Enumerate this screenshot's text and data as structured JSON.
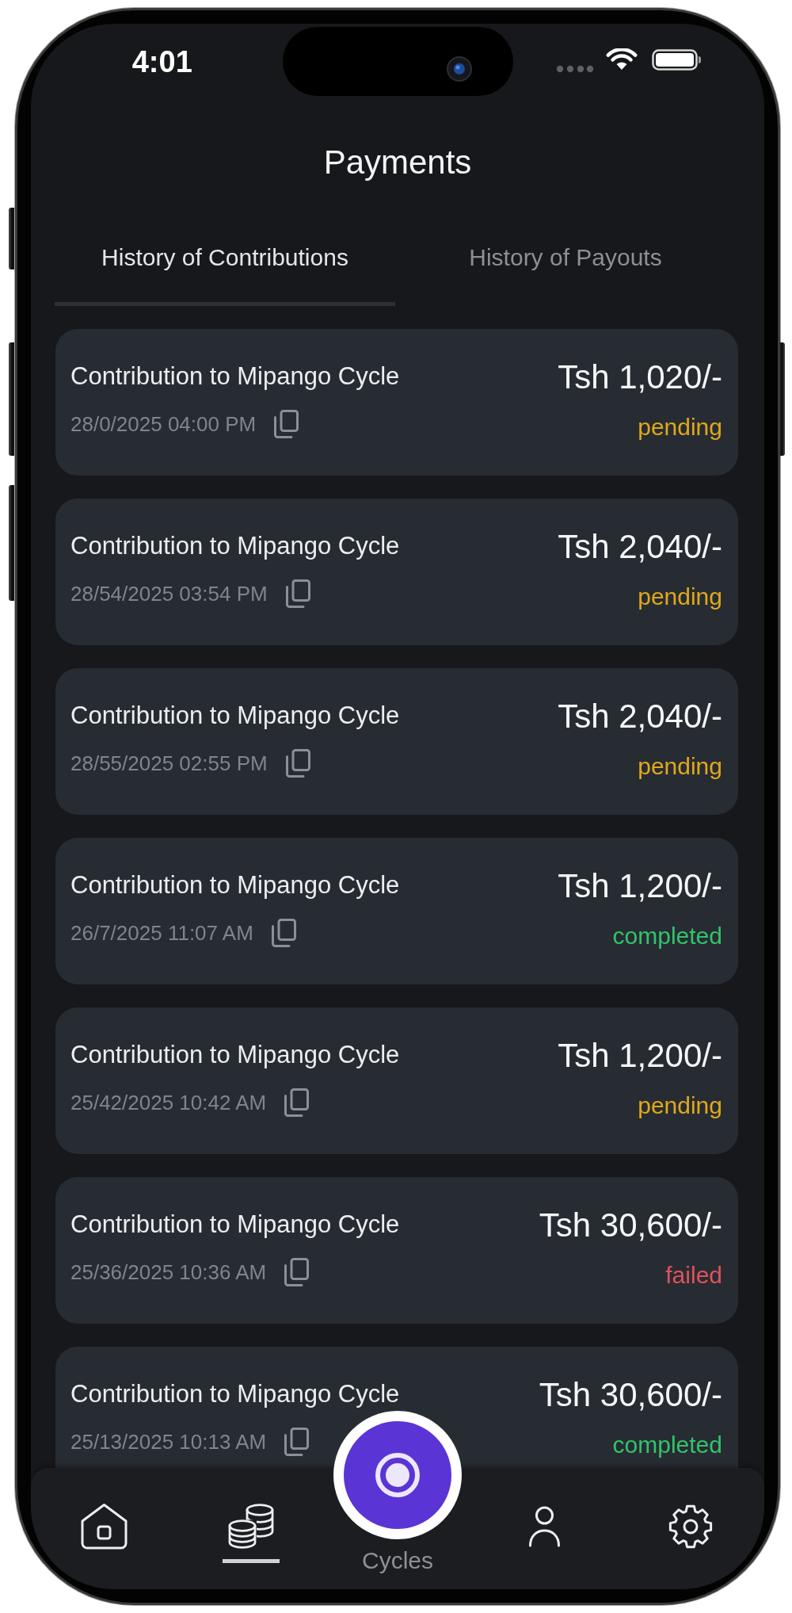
{
  "status_bar": {
    "time": "4:01"
  },
  "header": {
    "title": "Payments"
  },
  "tabs": [
    {
      "label": "History of Contributions",
      "selected": true
    },
    {
      "label": "History of Payouts",
      "selected": false
    }
  ],
  "payments": [
    {
      "title": "Contribution to Mipango Cycle",
      "date": "28/0/2025 04:00 PM",
      "amount": "Tsh 1,020/-",
      "status": "pending",
      "color": "#e0a81b"
    },
    {
      "title": "Contribution to Mipango Cycle",
      "date": "28/54/2025 03:54 PM",
      "amount": "Tsh 2,040/-",
      "status": "pending",
      "color": "#e0a81b"
    },
    {
      "title": "Contribution to Mipango Cycle",
      "date": "28/55/2025 02:55 PM",
      "amount": "Tsh 2,040/-",
      "status": "pending",
      "color": "#e0a81b"
    },
    {
      "title": "Contribution to Mipango Cycle",
      "date": "26/7/2025 11:07 AM",
      "amount": "Tsh 1,200/-",
      "status": "completed",
      "color": "#31c46a"
    },
    {
      "title": "Contribution to Mipango Cycle",
      "date": "25/42/2025 10:42 AM",
      "amount": "Tsh 1,200/-",
      "status": "pending",
      "color": "#e0a81b"
    },
    {
      "title": "Contribution to Mipango Cycle",
      "date": "25/36/2025 10:36 AM",
      "amount": "Tsh 30,600/-",
      "status": "failed",
      "color": "#e0525c"
    },
    {
      "title": "Contribution to Mipango Cycle",
      "date": "25/13/2025 10:13 AM",
      "amount": "Tsh 30,600/-",
      "status": "completed",
      "color": "#31c46a"
    }
  ],
  "bottom_nav": {
    "items": [
      {
        "kind": "icon",
        "selected": false
      },
      {
        "kind": "icon",
        "selected": true
      },
      {
        "kind": "fab",
        "label": "Cycles",
        "selected": false
      },
      {
        "kind": "icon",
        "selected": false
      },
      {
        "kind": "icon",
        "selected": false
      }
    ]
  }
}
